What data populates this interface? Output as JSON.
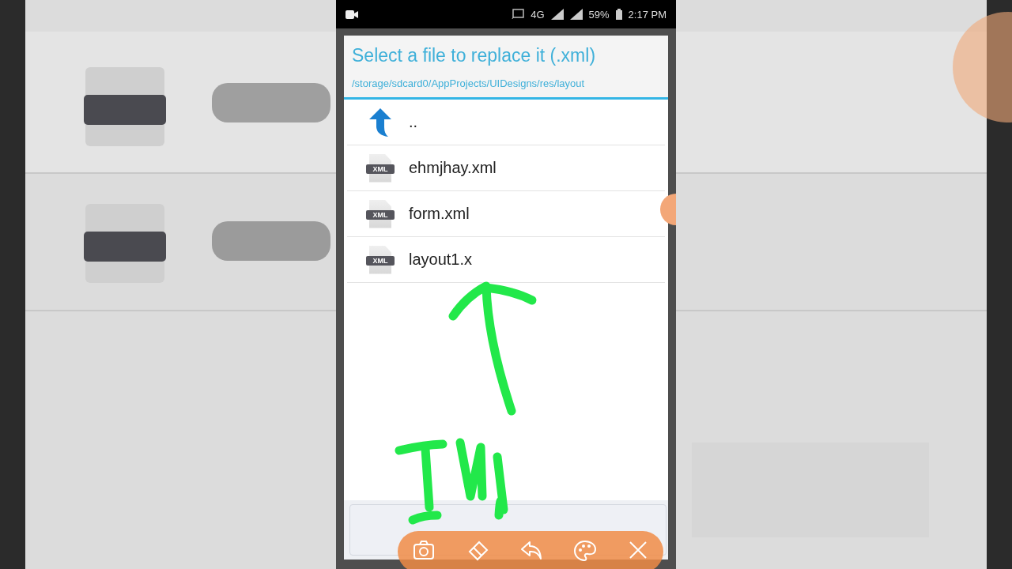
{
  "status_bar": {
    "network": "4G",
    "battery": "59%",
    "time": "2:17 PM"
  },
  "dialog": {
    "title": "Select a file to replace it (.xml)",
    "path": "/storage/sdcard0/AppProjects/UIDesigns/res/layout",
    "items": [
      {
        "kind": "parent",
        "name": ".."
      },
      {
        "kind": "file",
        "name": "ehmjhay.xml",
        "badge": "XML"
      },
      {
        "kind": "file",
        "name": "form.xml",
        "badge": "XML"
      },
      {
        "kind": "file",
        "name": "layout1.x",
        "badge": "XML"
      }
    ]
  },
  "recorder_toolbar": {
    "tools": [
      {
        "kind": "camera"
      },
      {
        "kind": "eraser"
      },
      {
        "kind": "undo"
      },
      {
        "kind": "palette"
      },
      {
        "kind": "close"
      }
    ]
  }
}
